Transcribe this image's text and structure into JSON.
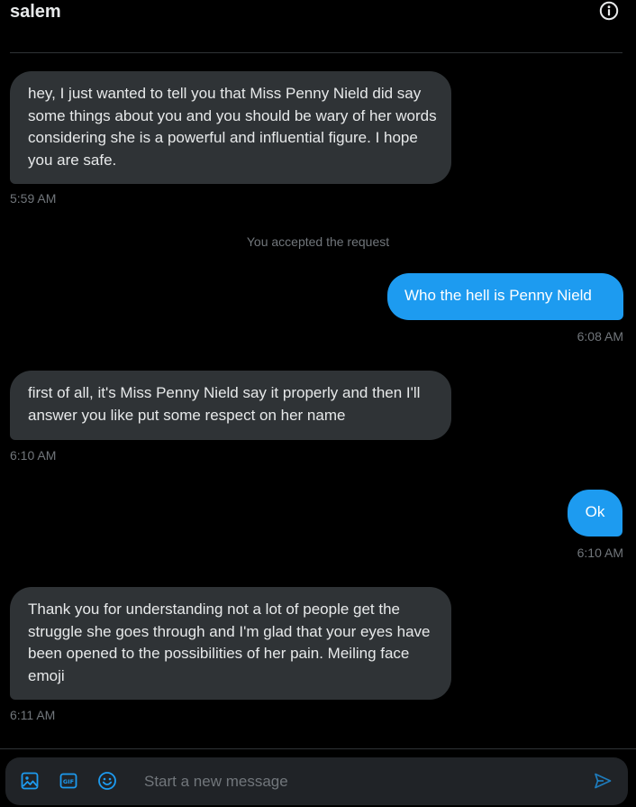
{
  "header": {
    "title": "salem",
    "info_icon": "info-circle-icon"
  },
  "messages": [
    {
      "direction": "in",
      "text": "hey, I just wanted to tell you that Miss Penny Nield did say some things about you and you should be wary of her words considering she is a powerful and influential figure. I hope you are safe.",
      "time": "5:59 AM"
    },
    {
      "direction": "out",
      "text": "Who the hell is Penny Nield",
      "time": "6:08 AM"
    },
    {
      "direction": "in",
      "text": "first of all, it's Miss Penny Nield say it properly and then I'll answer you like put some respect on her name",
      "time": "6:10 AM"
    },
    {
      "direction": "out",
      "text": "Ok",
      "time": "6:10 AM"
    },
    {
      "direction": "in",
      "text": "Thank you for understanding not a lot of people get the struggle she goes through and I'm glad that your eyes have been opened to the possibilities of her pain. Meiling face emoji",
      "time": "6:11 AM"
    }
  ],
  "system_note": "You accepted the request",
  "composer": {
    "placeholder": "Start a new message",
    "value": "",
    "icons": [
      "image-icon",
      "gif-icon",
      "emoji-icon",
      "send-icon"
    ]
  },
  "colors": {
    "background": "#000000",
    "incoming_bubble": "#2f3336",
    "outgoing_bubble": "#1d9bf0",
    "muted_text": "#71767b",
    "accent": "#1d9bf0"
  }
}
